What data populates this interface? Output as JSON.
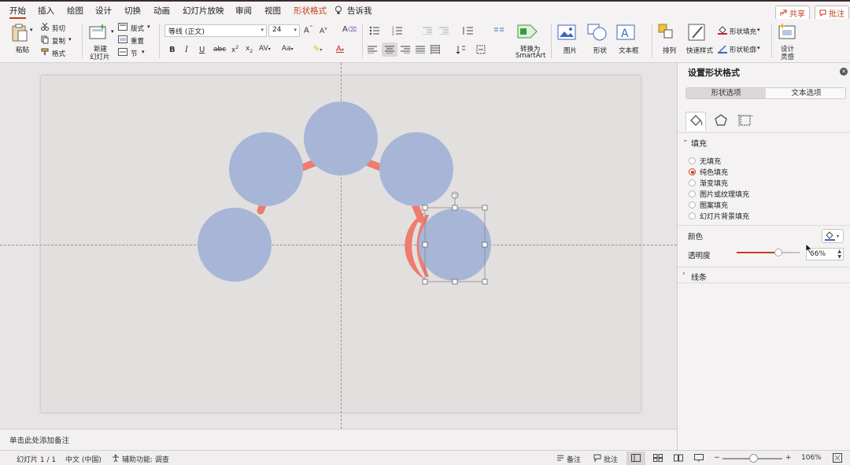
{
  "menu": {
    "tabs": [
      {
        "label": "开始",
        "active": true
      },
      {
        "label": "插入"
      },
      {
        "label": "绘图"
      },
      {
        "label": "设计"
      },
      {
        "label": "切换"
      },
      {
        "label": "动画"
      },
      {
        "label": "幻灯片放映"
      },
      {
        "label": "审阅"
      },
      {
        "label": "视图"
      },
      {
        "label": "形状格式",
        "accent": true
      }
    ],
    "tell_me": "告诉我",
    "share": "共享",
    "comments": "批注"
  },
  "ribbon": {
    "paste": "粘贴",
    "cut": "剪切",
    "copy": "复制",
    "format_painter": "格式",
    "new_slide_line1": "新建",
    "new_slide_line2": "幻灯片",
    "layout": "版式",
    "reset": "重置",
    "section": "节",
    "font_name": "等线 (正文)",
    "font_size": "24",
    "convert_line1": "转换为",
    "convert_line2": "SmartArt",
    "picture": "图片",
    "shape": "形状",
    "textbox": "文本框",
    "arrange": "排列",
    "quick_styles": "快速样式",
    "shape_fill": "形状填充",
    "shape_outline": "形状轮廓",
    "designer_line1": "设计",
    "designer_line2": "灵感"
  },
  "notes_placeholder": "单击此处添加备注",
  "status": {
    "slide": "幻灯片 1 / 1",
    "language": "中文 (中国)",
    "accessibility": "辅助功能: 调查",
    "notes": "备注",
    "comments": "批注",
    "zoom": "106%"
  },
  "pane": {
    "title": "设置形状格式",
    "tabs": [
      "形状选项",
      "文本选项"
    ],
    "fill_section": "填充",
    "fill_options": [
      "无填充",
      "纯色填充",
      "渐变填充",
      "图片或纹理填充",
      "图案填充",
      "幻灯片背景填充"
    ],
    "selected_fill_index": 1,
    "color_label": "颜色",
    "transparency_label": "透明度",
    "transparency_value": "66%",
    "transparency": 0.66,
    "line_section": "线条"
  },
  "colors": {
    "accent": "#c43e1c",
    "circle_fill": "#a7b6d6",
    "arc": "#ee7c6f",
    "slide_bg": "#e2dfdf"
  },
  "icons": [
    "clipboard-icon",
    "scissors-icon",
    "copy-icon",
    "brush-icon",
    "new-slide-icon",
    "bold-icon",
    "italic-icon",
    "underline-icon",
    "strikethrough-icon",
    "superscript-icon",
    "subscript-icon",
    "highlight-icon",
    "font-color-icon",
    "bullets-icon",
    "numbering-icon",
    "align-left-icon",
    "align-center-icon",
    "align-right-icon",
    "justify-icon",
    "picture-icon",
    "shapes-icon",
    "textbox-icon",
    "arrange-icon",
    "quick-styles-icon",
    "paint-bucket-icon",
    "pentagon-icon",
    "size-icon",
    "close-icon",
    "rotate-handle-icon",
    "lightbulb-icon",
    "share-icon",
    "comment-icon",
    "normal-view-icon",
    "slide-sorter-icon",
    "reading-view-icon",
    "slideshow-icon",
    "mouse-cursor-icon"
  ]
}
